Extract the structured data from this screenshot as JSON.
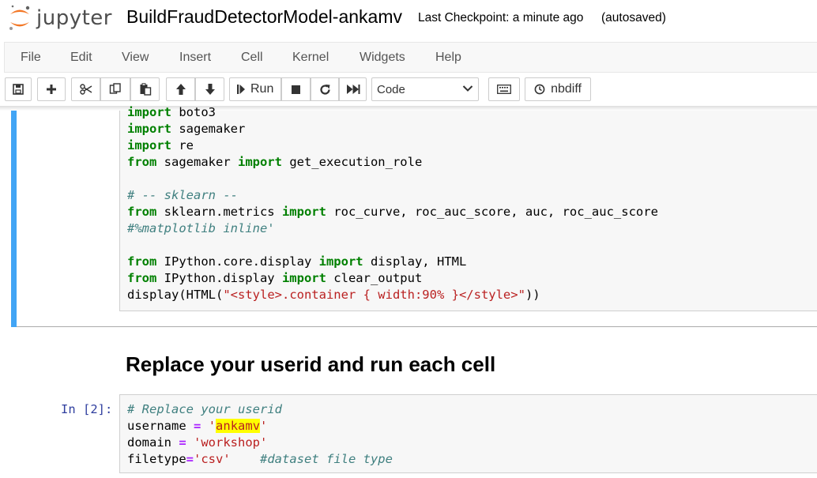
{
  "header": {
    "logo_text": "jupyter",
    "notebook_title": "BuildFraudDetectorModel-ankamv",
    "checkpoint": "Last Checkpoint: a minute ago",
    "autosave": "(autosaved)"
  },
  "menu": {
    "file": "File",
    "edit": "Edit",
    "view": "View",
    "insert": "Insert",
    "cell": "Cell",
    "kernel": "Kernel",
    "widgets": "Widgets",
    "help": "Help"
  },
  "toolbar": {
    "run_label": "Run",
    "cell_type": "Code",
    "nbdiff_label": "nbdiff",
    "icons": [
      "save-icon",
      "plus-icon",
      "cut-icon",
      "copy-icon",
      "paste-icon",
      "arrow-up-icon",
      "arrow-down-icon",
      "step-forward-icon",
      "stop-icon",
      "restart-icon",
      "fast-forward-icon",
      "keyboard-icon",
      "clock-icon"
    ]
  },
  "cell1": {
    "lines": {
      "l1_kw": "import",
      "l1_rest": " boto3",
      "l2_kw": "import",
      "l2_rest": " sagemaker",
      "l3_kw": "import",
      "l3_rest": " re",
      "l4_kw1": "from",
      "l4_mid": " sagemaker ",
      "l4_kw2": "import",
      "l4_rest": " get_execution_role",
      "l5_comment": "# -- sklearn --",
      "l6_kw1": "from",
      "l6_mid": " sklearn.metrics ",
      "l6_kw2": "import",
      "l6_rest": " roc_curve, roc_auc_score, auc, roc_auc_score",
      "l7_comment": "#%matplotlib inline'",
      "l8_kw1": "from",
      "l8_mid": " IPython.core.display ",
      "l8_kw2": "import",
      "l8_rest": " display, HTML",
      "l9_kw1": "from",
      "l9_mid": " IPython.display ",
      "l9_kw2": "import",
      "l9_rest": " clear_output",
      "l10_pre": "display(HTML(",
      "l10_str": "\"<style>.container { width:90% }</style>\"",
      "l10_post": "))"
    }
  },
  "markdown": {
    "heading": "Replace your userid and run each cell"
  },
  "cell2": {
    "prompt": "In [2]:",
    "l1_comment": "# Replace your userid",
    "l2_var": "username ",
    "l2_op": "=",
    "l2_sp": " ",
    "l2_str_open": "'",
    "l2_str_val": "ankamv",
    "l2_str_close": "'",
    "l3_var": "domain ",
    "l3_op": "=",
    "l3_sp": " ",
    "l3_str": "'workshop'",
    "l4_var": "filetype",
    "l4_op": "=",
    "l4_str": "'csv'",
    "l4_sp": "    ",
    "l4_comment": "#dataset file type"
  },
  "colors": {
    "accent_blue": "#42a5f5",
    "keyword_green": "#008000",
    "string_red": "#ba2121",
    "comment_teal": "#408080",
    "prompt_blue": "#303f9f",
    "highlight_yellow": "#ffff00"
  }
}
